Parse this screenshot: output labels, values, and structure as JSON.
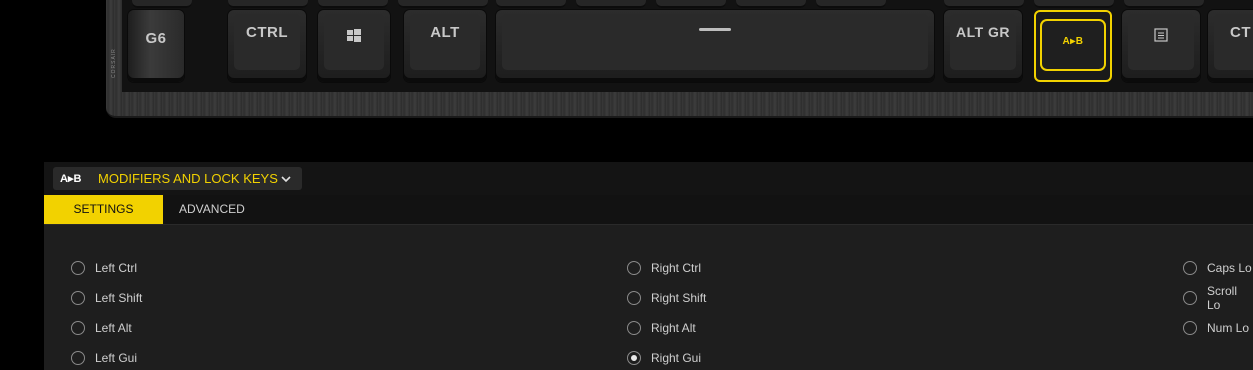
{
  "keyboard": {
    "keys": {
      "g6": "G6",
      "ctrl_left": "CTRL",
      "alt_left": "ALT",
      "alt_gr": "ALT GR",
      "remap": "A▸B",
      "ctrl_right": "CT"
    },
    "brand_vertical": "CORSAIR",
    "icons": [
      "windows-logo-icon",
      "menu-icon",
      "spacebar-line-icon"
    ]
  },
  "panel": {
    "dropdown": {
      "badge": "A▸B",
      "label": "MODIFIERS AND LOCK KEYS"
    },
    "tabs": [
      {
        "label": "SETTINGS",
        "active": true
      },
      {
        "label": "ADVANCED",
        "active": false
      }
    ],
    "options": {
      "col1": [
        {
          "label": "Left Ctrl",
          "selected": false
        },
        {
          "label": "Left Shift",
          "selected": false
        },
        {
          "label": "Left Alt",
          "selected": false
        },
        {
          "label": "Left Gui",
          "selected": false
        }
      ],
      "col2": [
        {
          "label": "Right Ctrl",
          "selected": false
        },
        {
          "label": "Right Shift",
          "selected": false
        },
        {
          "label": "Right Alt",
          "selected": false
        },
        {
          "label": "Right Gui",
          "selected": true
        }
      ],
      "col3": [
        {
          "label": "Caps Lo",
          "selected": false
        },
        {
          "label": "Scroll Lo",
          "selected": false
        },
        {
          "label": "Num Lo",
          "selected": false
        }
      ]
    }
  },
  "colors": {
    "accent": "#f2d200",
    "background": "#000000",
    "panel": "#1e1e1e"
  }
}
